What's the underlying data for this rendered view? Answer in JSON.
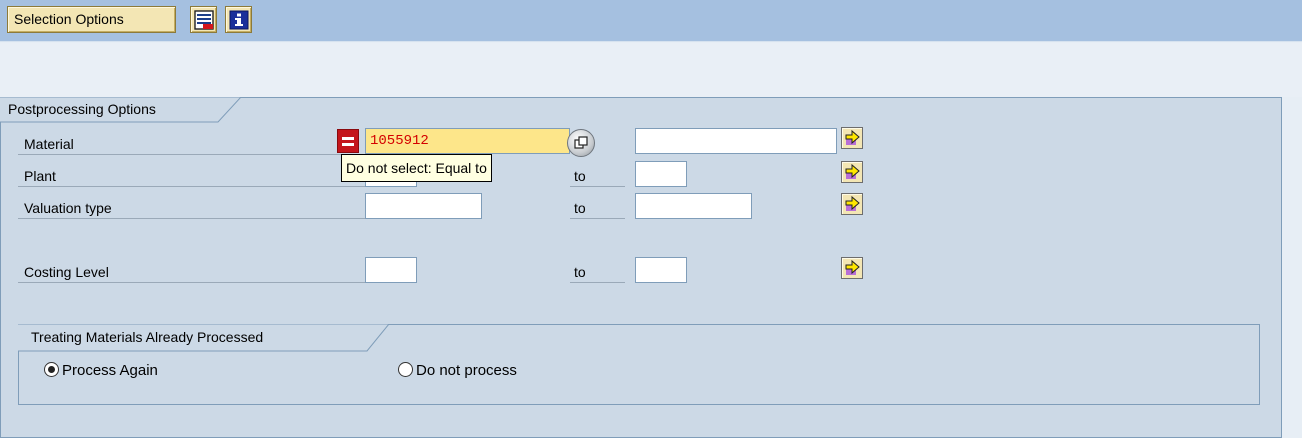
{
  "toolbar": {
    "selection_options": "Selection Options",
    "icons": [
      "save-variant-icon",
      "info-icon"
    ]
  },
  "group": {
    "title": "Postprocessing Options",
    "rows": [
      {
        "label": "Material",
        "from_value": "1055912",
        "to_label": "",
        "to_value": ""
      },
      {
        "label": "Plant",
        "from_value": "",
        "to_label": "to",
        "to_value": ""
      },
      {
        "label": "Valuation type",
        "from_value": "",
        "to_label": "to",
        "to_value": ""
      },
      {
        "label": "Costing Level",
        "from_value": "",
        "to_label": "to",
        "to_value": ""
      }
    ],
    "tooltip": "Do not select: Equal to"
  },
  "subgroup": {
    "title": "Treating Materials Already Processed",
    "options": [
      {
        "label": "Process Again",
        "selected": true
      },
      {
        "label": "Do not process",
        "selected": false
      }
    ]
  },
  "colors": {
    "toolbar_bg": "#a5c0e0",
    "group_bg": "#ccd9e6",
    "active_field_bg": "#fde68a",
    "active_field_text": "#d40000",
    "button_bg": "#f3e6b4"
  }
}
